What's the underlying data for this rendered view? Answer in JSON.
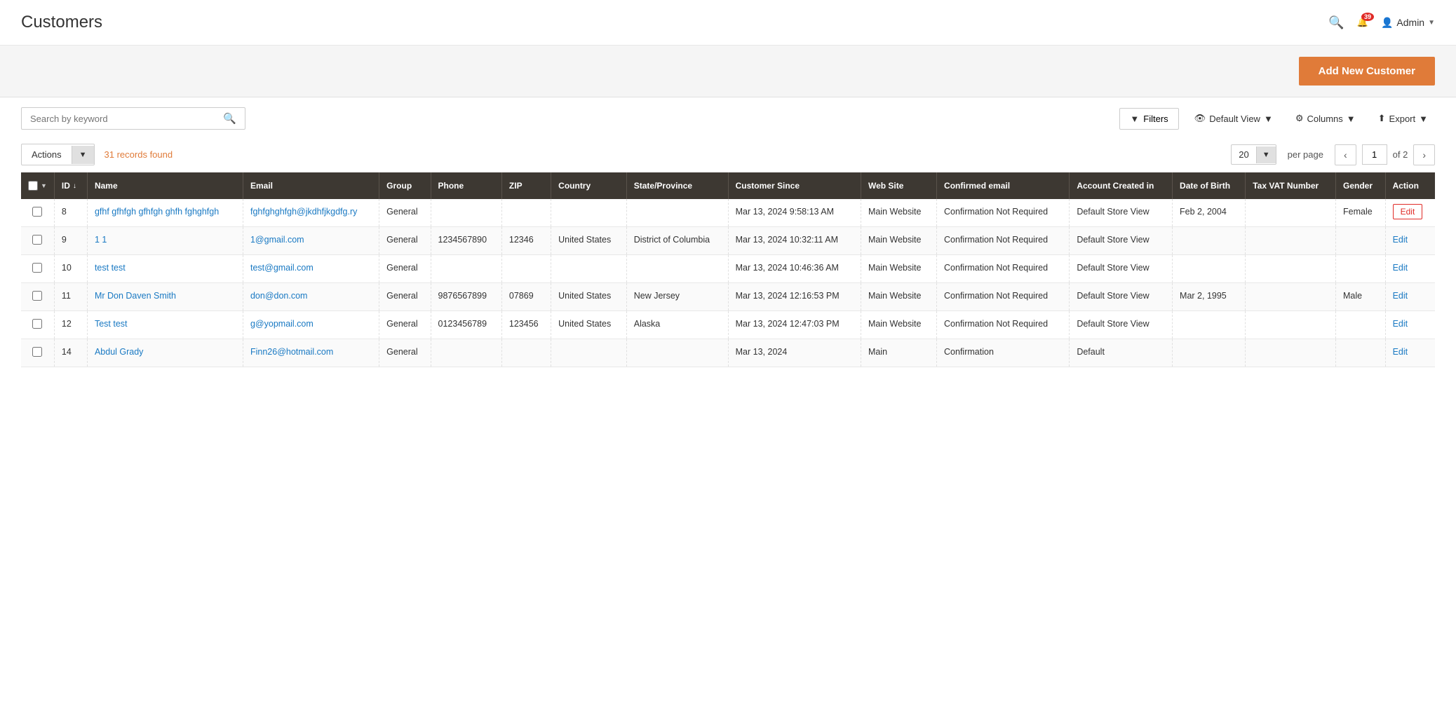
{
  "header": {
    "title": "Customers",
    "search_icon": "🔍",
    "bell_icon": "🔔",
    "bell_count": "39",
    "admin_label": "Admin",
    "admin_arrow": "▼"
  },
  "action_bar": {
    "add_button_label": "Add New Customer"
  },
  "toolbar": {
    "search_placeholder": "Search by keyword",
    "filter_label": "Filters",
    "view_label": "Default View",
    "columns_label": "Columns",
    "export_label": "Export"
  },
  "records_bar": {
    "actions_label": "Actions",
    "records_found": "31 records found",
    "per_page_value": "20",
    "per_page_label": "per page",
    "current_page": "1",
    "total_pages": "of 2"
  },
  "table": {
    "columns": [
      "",
      "ID ↓",
      "Name",
      "Email",
      "Group",
      "Phone",
      "ZIP",
      "Country",
      "State/Province",
      "Customer Since",
      "Web Site",
      "Confirmed email",
      "Account Created in",
      "Date of Birth",
      "Tax VAT Number",
      "Gender",
      "Action"
    ],
    "rows": [
      {
        "id": "8",
        "name": "gfhf gfhfgh gfhfgh ghfh fghghfgh",
        "email": "fghfghghfgh@jkdhfjkgdfg.ry",
        "group": "General",
        "phone": "",
        "zip": "",
        "country": "",
        "state": "",
        "customer_since": "Mar 13, 2024 9:58:13 AM",
        "website": "Main Website",
        "confirmed_email": "Confirmation Not Required",
        "account_created": "Default Store View",
        "dob": "Feb 2, 2004",
        "tax_vat": "",
        "gender": "Female",
        "action": "Edit",
        "action_type": "red"
      },
      {
        "id": "9",
        "name": "1 1",
        "email": "1@gmail.com",
        "group": "General",
        "phone": "1234567890",
        "zip": "12346",
        "country": "United States",
        "state": "District of Columbia",
        "customer_since": "Mar 13, 2024 10:32:11 AM",
        "website": "Main Website",
        "confirmed_email": "Confirmation Not Required",
        "account_created": "Default Store View",
        "dob": "",
        "tax_vat": "",
        "gender": "",
        "action": "Edit",
        "action_type": "blue"
      },
      {
        "id": "10",
        "name": "test test",
        "email": "test@gmail.com",
        "group": "General",
        "phone": "",
        "zip": "",
        "country": "",
        "state": "",
        "customer_since": "Mar 13, 2024 10:46:36 AM",
        "website": "Main Website",
        "confirmed_email": "Confirmation Not Required",
        "account_created": "Default Store View",
        "dob": "",
        "tax_vat": "",
        "gender": "",
        "action": "Edit",
        "action_type": "blue"
      },
      {
        "id": "11",
        "name": "Mr Don Daven Smith",
        "email": "don@don.com",
        "group": "General",
        "phone": "9876567899",
        "zip": "07869",
        "country": "United States",
        "state": "New Jersey",
        "customer_since": "Mar 13, 2024 12:16:53 PM",
        "website": "Main Website",
        "confirmed_email": "Confirmation Not Required",
        "account_created": "Default Store View",
        "dob": "Mar 2, 1995",
        "tax_vat": "",
        "gender": "Male",
        "action": "Edit",
        "action_type": "blue"
      },
      {
        "id": "12",
        "name": "Test test",
        "email": "g@yopmail.com",
        "group": "General",
        "phone": "0123456789",
        "zip": "123456",
        "country": "United States",
        "state": "Alaska",
        "customer_since": "Mar 13, 2024 12:47:03 PM",
        "website": "Main Website",
        "confirmed_email": "Confirmation Not Required",
        "account_created": "Default Store View",
        "dob": "",
        "tax_vat": "",
        "gender": "",
        "action": "Edit",
        "action_type": "blue"
      },
      {
        "id": "14",
        "name": "Abdul Grady",
        "email": "Finn26@hotmail.com",
        "group": "General",
        "phone": "",
        "zip": "",
        "country": "",
        "state": "",
        "customer_since": "Mar 13, 2024",
        "website": "Main",
        "confirmed_email": "Confirmation",
        "account_created": "Default",
        "dob": "",
        "tax_vat": "",
        "gender": "",
        "action": "Edit",
        "action_type": "blue"
      }
    ]
  }
}
